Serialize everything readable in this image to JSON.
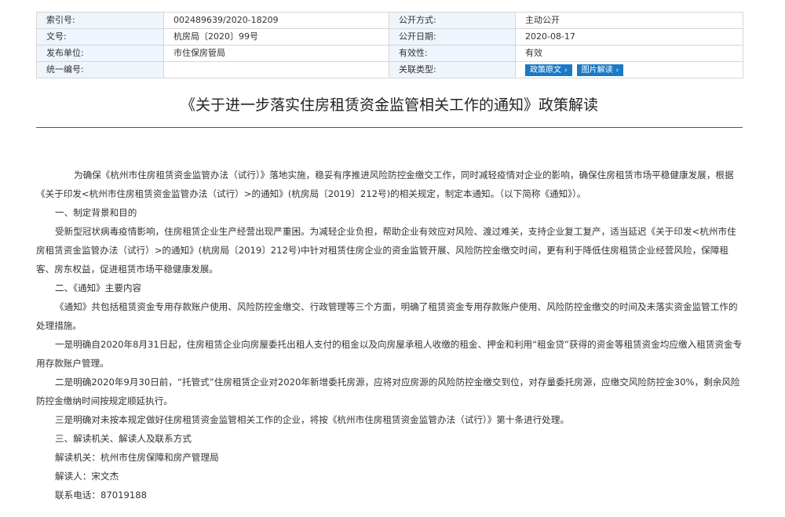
{
  "meta": {
    "index_label": "索引号:",
    "index_value": "002489639/2020-18209",
    "disclosure_label": "公开方式:",
    "disclosure_value": "主动公开",
    "doc_no_label": "文号:",
    "doc_no_value": "杭房局〔2020〕99号",
    "date_label": "公开日期:",
    "date_value": "2020-08-17",
    "issuer_label": "发布单位:",
    "issuer_value": "市住保房管局",
    "validity_label": "有效性:",
    "validity_value": "有效",
    "unified_label": "统一编号:",
    "unified_value": "",
    "related_label": "关联类型:",
    "btn_policy": "政策原文",
    "btn_image": "图片解读",
    "btn_chevron": "›"
  },
  "title": "《关于进一步落实住房租赁资金监管相关工作的通知》政策解读",
  "paragraphs": [
    "为确保《杭州市住房租赁资金监管办法（试行）》落地实施，稳妥有序推进风险防控金缴交工作，同时减轻疫情对企业的影响，确保住房租赁市场平稳健康发展，根据《关于印发<杭州市住房租赁资金监管办法（试行）>的通知》(杭房局〔2019〕212号)的相关规定，制定本通知。（以下简称《通知》）。",
    "一、制定背景和目的",
    "受新型冠状病毒疫情影响，住房租赁企业生产经营出现严重困。为减轻企业负担，帮助企业有效应对风险、渡过难关，支持企业复工复产，适当延迟《关于印发<杭州市住房租赁资金监管办法（试行）>的通知》(杭房局〔2019〕212号)中针对租赁住房企业的资金监管开展、风险防控金缴交时间，更有利于降低住房租赁企业经营风险，保障租客、房东权益，促进租赁市场平稳健康发展。",
    "二、《通知》主要内容",
    "《通知》共包括租赁资金专用存款账户使用、风险防控金缴交、行政管理等三个方面，明确了租赁资金专用存款账户使用、风险防控金缴交的时间及未落实资金监管工作的处理措施。",
    "一是明确自2020年8月31日起，住房租赁企业向房屋委托出租人支付的租金以及向房屋承租人收缴的租金、押金和利用“租金贷”获得的资金等租赁资金均应缴入租赁资金专用存款账户管理。",
    "二是明确2020年9月30日前，“托管式”住房租赁企业对2020年新增委托房源，应将对应房源的风险防控金缴交到位，对存量委托房源，应缴交风险防控金30%，剩余风险防控金缴纳时间按规定顺延执行。",
    "三是明确对未按本规定做好住房租赁资金监管相关工作的企业，将按《杭州市住房租赁资金监管办法（试行）》第十条进行处理。",
    "三、解读机关、解读人及联系方式",
    "解读机关：杭州市住房保障和房产管理局",
    "解读人：宋文杰",
    "联系电话：87019188"
  ]
}
